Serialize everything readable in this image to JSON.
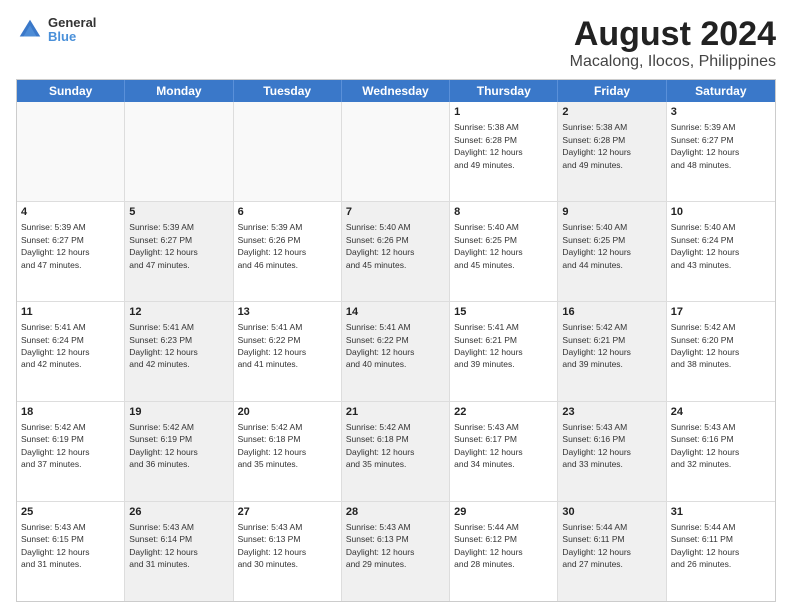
{
  "logo": {
    "line1": "General",
    "line2": "Blue"
  },
  "title": "August 2024",
  "subtitle": "Macalong, Ilocos, Philippines",
  "weekdays": [
    "Sunday",
    "Monday",
    "Tuesday",
    "Wednesday",
    "Thursday",
    "Friday",
    "Saturday"
  ],
  "rows": [
    [
      {
        "day": "",
        "text": "",
        "empty": true
      },
      {
        "day": "",
        "text": "",
        "empty": true
      },
      {
        "day": "",
        "text": "",
        "empty": true
      },
      {
        "day": "",
        "text": "",
        "empty": true
      },
      {
        "day": "1",
        "text": "Sunrise: 5:38 AM\nSunset: 6:28 PM\nDaylight: 12 hours\nand 49 minutes.",
        "empty": false,
        "shaded": false
      },
      {
        "day": "2",
        "text": "Sunrise: 5:38 AM\nSunset: 6:28 PM\nDaylight: 12 hours\nand 49 minutes.",
        "empty": false,
        "shaded": true
      },
      {
        "day": "3",
        "text": "Sunrise: 5:39 AM\nSunset: 6:27 PM\nDaylight: 12 hours\nand 48 minutes.",
        "empty": false,
        "shaded": false
      }
    ],
    [
      {
        "day": "4",
        "text": "Sunrise: 5:39 AM\nSunset: 6:27 PM\nDaylight: 12 hours\nand 47 minutes.",
        "empty": false,
        "shaded": false
      },
      {
        "day": "5",
        "text": "Sunrise: 5:39 AM\nSunset: 6:27 PM\nDaylight: 12 hours\nand 47 minutes.",
        "empty": false,
        "shaded": true
      },
      {
        "day": "6",
        "text": "Sunrise: 5:39 AM\nSunset: 6:26 PM\nDaylight: 12 hours\nand 46 minutes.",
        "empty": false,
        "shaded": false
      },
      {
        "day": "7",
        "text": "Sunrise: 5:40 AM\nSunset: 6:26 PM\nDaylight: 12 hours\nand 45 minutes.",
        "empty": false,
        "shaded": true
      },
      {
        "day": "8",
        "text": "Sunrise: 5:40 AM\nSunset: 6:25 PM\nDaylight: 12 hours\nand 45 minutes.",
        "empty": false,
        "shaded": false
      },
      {
        "day": "9",
        "text": "Sunrise: 5:40 AM\nSunset: 6:25 PM\nDaylight: 12 hours\nand 44 minutes.",
        "empty": false,
        "shaded": true
      },
      {
        "day": "10",
        "text": "Sunrise: 5:40 AM\nSunset: 6:24 PM\nDaylight: 12 hours\nand 43 minutes.",
        "empty": false,
        "shaded": false
      }
    ],
    [
      {
        "day": "11",
        "text": "Sunrise: 5:41 AM\nSunset: 6:24 PM\nDaylight: 12 hours\nand 42 minutes.",
        "empty": false,
        "shaded": false
      },
      {
        "day": "12",
        "text": "Sunrise: 5:41 AM\nSunset: 6:23 PM\nDaylight: 12 hours\nand 42 minutes.",
        "empty": false,
        "shaded": true
      },
      {
        "day": "13",
        "text": "Sunrise: 5:41 AM\nSunset: 6:22 PM\nDaylight: 12 hours\nand 41 minutes.",
        "empty": false,
        "shaded": false
      },
      {
        "day": "14",
        "text": "Sunrise: 5:41 AM\nSunset: 6:22 PM\nDaylight: 12 hours\nand 40 minutes.",
        "empty": false,
        "shaded": true
      },
      {
        "day": "15",
        "text": "Sunrise: 5:41 AM\nSunset: 6:21 PM\nDaylight: 12 hours\nand 39 minutes.",
        "empty": false,
        "shaded": false
      },
      {
        "day": "16",
        "text": "Sunrise: 5:42 AM\nSunset: 6:21 PM\nDaylight: 12 hours\nand 39 minutes.",
        "empty": false,
        "shaded": true
      },
      {
        "day": "17",
        "text": "Sunrise: 5:42 AM\nSunset: 6:20 PM\nDaylight: 12 hours\nand 38 minutes.",
        "empty": false,
        "shaded": false
      }
    ],
    [
      {
        "day": "18",
        "text": "Sunrise: 5:42 AM\nSunset: 6:19 PM\nDaylight: 12 hours\nand 37 minutes.",
        "empty": false,
        "shaded": false
      },
      {
        "day": "19",
        "text": "Sunrise: 5:42 AM\nSunset: 6:19 PM\nDaylight: 12 hours\nand 36 minutes.",
        "empty": false,
        "shaded": true
      },
      {
        "day": "20",
        "text": "Sunrise: 5:42 AM\nSunset: 6:18 PM\nDaylight: 12 hours\nand 35 minutes.",
        "empty": false,
        "shaded": false
      },
      {
        "day": "21",
        "text": "Sunrise: 5:42 AM\nSunset: 6:18 PM\nDaylight: 12 hours\nand 35 minutes.",
        "empty": false,
        "shaded": true
      },
      {
        "day": "22",
        "text": "Sunrise: 5:43 AM\nSunset: 6:17 PM\nDaylight: 12 hours\nand 34 minutes.",
        "empty": false,
        "shaded": false
      },
      {
        "day": "23",
        "text": "Sunrise: 5:43 AM\nSunset: 6:16 PM\nDaylight: 12 hours\nand 33 minutes.",
        "empty": false,
        "shaded": true
      },
      {
        "day": "24",
        "text": "Sunrise: 5:43 AM\nSunset: 6:16 PM\nDaylight: 12 hours\nand 32 minutes.",
        "empty": false,
        "shaded": false
      }
    ],
    [
      {
        "day": "25",
        "text": "Sunrise: 5:43 AM\nSunset: 6:15 PM\nDaylight: 12 hours\nand 31 minutes.",
        "empty": false,
        "shaded": false
      },
      {
        "day": "26",
        "text": "Sunrise: 5:43 AM\nSunset: 6:14 PM\nDaylight: 12 hours\nand 31 minutes.",
        "empty": false,
        "shaded": true
      },
      {
        "day": "27",
        "text": "Sunrise: 5:43 AM\nSunset: 6:13 PM\nDaylight: 12 hours\nand 30 minutes.",
        "empty": false,
        "shaded": false
      },
      {
        "day": "28",
        "text": "Sunrise: 5:43 AM\nSunset: 6:13 PM\nDaylight: 12 hours\nand 29 minutes.",
        "empty": false,
        "shaded": true
      },
      {
        "day": "29",
        "text": "Sunrise: 5:44 AM\nSunset: 6:12 PM\nDaylight: 12 hours\nand 28 minutes.",
        "empty": false,
        "shaded": false
      },
      {
        "day": "30",
        "text": "Sunrise: 5:44 AM\nSunset: 6:11 PM\nDaylight: 12 hours\nand 27 minutes.",
        "empty": false,
        "shaded": true
      },
      {
        "day": "31",
        "text": "Sunrise: 5:44 AM\nSunset: 6:11 PM\nDaylight: 12 hours\nand 26 minutes.",
        "empty": false,
        "shaded": false
      }
    ]
  ]
}
